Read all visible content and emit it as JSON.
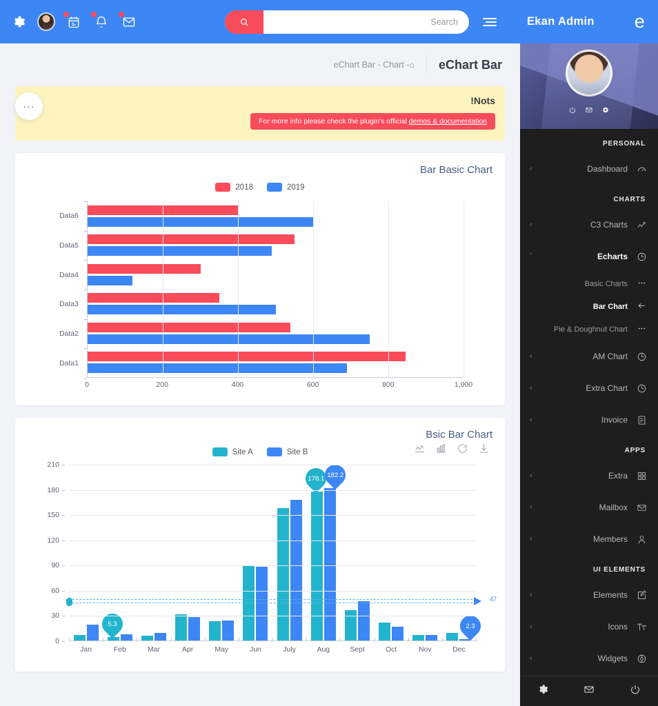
{
  "topbar": {
    "icons": [
      {
        "name": "gear-icon",
        "badge": false
      },
      {
        "name": "user-avatar",
        "badge": false
      },
      {
        "name": "calendar-icon",
        "badge": true
      },
      {
        "name": "bell-icon",
        "badge": true
      },
      {
        "name": "envelope-icon",
        "badge": true
      }
    ],
    "search": {
      "placeholder": "Search",
      "value": ""
    },
    "brand": "Ekan Admin",
    "brand_logo": "e",
    "colors": {
      "bar": "#3d86f5",
      "accent": "#fa4b5a"
    }
  },
  "page": {
    "fab_label": "···",
    "breadcrumb": "eChart Bar -   Chart -",
    "breadcrumb_home_icon": "home-icon",
    "title": "eChart Bar"
  },
  "notice": {
    "title": "!Nots",
    "text_before": "For more info please check the plugin's official ",
    "link": "demos & documentation",
    "bg": "#fdf4bf",
    "pill_bg": "#fa4b5a"
  },
  "cards": [
    {
      "title": "Bar Basic Chart"
    },
    {
      "title": "Bsic Bar Chart"
    }
  ],
  "chart_toolbar": [
    {
      "name": "line-chart-icon"
    },
    {
      "name": "bar-chart-icon"
    },
    {
      "name": "restore-icon"
    },
    {
      "name": "download-icon"
    }
  ],
  "chart_data": [
    {
      "type": "bar",
      "orientation": "horizontal",
      "title": "Bar Basic Chart",
      "categories": [
        "Data1",
        "Data2",
        "Data3",
        "Data4",
        "Data5",
        "Data6"
      ],
      "series": [
        {
          "name": "2018",
          "color": "#fa4b5a",
          "values": [
            845,
            540,
            350,
            300,
            550,
            400
          ]
        },
        {
          "name": "2019",
          "color": "#3d86f5",
          "values": [
            690,
            750,
            500,
            120,
            490,
            600
          ]
        }
      ],
      "xlabel": "",
      "ylabel": "",
      "xlim": [
        0,
        1000
      ],
      "xticks": [
        0,
        200,
        400,
        600,
        800,
        1000
      ],
      "xtick_labels": [
        "0",
        "200",
        "400",
        "600",
        "800",
        "1,000"
      ],
      "grid": true,
      "legend_position": "top-center",
      "display_order_top_to_bottom": [
        "Data6",
        "Data5",
        "Data4",
        "Data3",
        "Data2",
        "Data1"
      ]
    },
    {
      "type": "bar",
      "orientation": "vertical",
      "title": "Bsic Bar Chart",
      "categories": [
        "Jan",
        "Feb",
        "Mar",
        "Apr",
        "May",
        "Jun",
        "July",
        "Aug",
        "Sept",
        "Oct",
        "Nov",
        "Dec"
      ],
      "series": [
        {
          "name": "Site A",
          "color": "#23b4cd",
          "values": [
            7.5,
            5.3,
            6.5,
            32,
            23.5,
            90,
            158,
            178.1,
            37,
            22.5,
            7.5,
            9.5
          ]
        },
        {
          "name": "Site B",
          "color": "#3d86f5",
          "values": [
            20,
            8.5,
            9.5,
            28.5,
            25,
            89,
            168,
            182.2,
            48,
            17,
            7.5,
            2.3
          ]
        }
      ],
      "xlabel": "",
      "ylabel": "",
      "ylim": [
        0,
        210
      ],
      "yticks": [
        0,
        30,
        60,
        90,
        120,
        150,
        180,
        210
      ],
      "ytick_labels": [
        "0",
        "30",
        "60",
        "90",
        "120",
        "150",
        "180",
        "210"
      ],
      "grid": true,
      "legend_position": "top-center",
      "annotations": [
        {
          "label": "178.1",
          "series": "Site A",
          "category": "Aug",
          "type": "max-pin",
          "color": "#23b4cd"
        },
        {
          "label": "5.3",
          "series": "Site A",
          "category": "Feb",
          "type": "min-pin",
          "color": "#23b4cd"
        },
        {
          "label": "182.2",
          "series": "Site B",
          "category": "Aug",
          "type": "max-pin",
          "color": "#3d86f5"
        },
        {
          "label": "2.3",
          "series": "Site B",
          "category": "Dec",
          "type": "min-pin",
          "color": "#3d86f5"
        },
        {
          "label": "47",
          "type": "average-markline",
          "value": 48,
          "color": "#56b7f0"
        }
      ]
    }
  ],
  "sidebar": {
    "profile_icons": [
      {
        "name": "power-icon"
      },
      {
        "name": "envelope-icon"
      },
      {
        "name": "settings-dot-icon"
      }
    ],
    "groups": [
      {
        "heading": "PERSONAL",
        "items": [
          {
            "label": "Dashboard",
            "icon": "speedometer-icon",
            "chevron": "‹",
            "state": ""
          }
        ]
      },
      {
        "heading": "CHARTS",
        "items": [
          {
            "label": "C3 Charts",
            "icon": "trend-line-icon",
            "chevron": "‹",
            "state": ""
          },
          {
            "label": "Echarts",
            "icon": "pie-clock-icon",
            "chevron": "ˇ",
            "state": "open",
            "children": [
              {
                "label": "Basic Charts",
                "icon": "ellipsis-icon",
                "state": ""
              },
              {
                "label": "Bar Chart",
                "icon": "arrow-left-icon",
                "state": "active"
              },
              {
                "label": "Pie & Doughnut Chart",
                "icon": "ellipsis-icon",
                "state": ""
              }
            ]
          },
          {
            "label": "AM Chart",
            "icon": "pie-clock-icon",
            "chevron": "‹",
            "state": ""
          },
          {
            "label": "Extra Chart",
            "icon": "pie-clock-icon",
            "chevron": "‹",
            "state": ""
          },
          {
            "label": "Invoice",
            "icon": "document-icon",
            "chevron": "‹",
            "state": ""
          }
        ]
      },
      {
        "heading": "APPS",
        "items": [
          {
            "label": "Extra",
            "icon": "grid-icon",
            "chevron": "‹",
            "state": ""
          },
          {
            "label": "Mailbox",
            "icon": "envelope-icon",
            "chevron": "‹",
            "state": ""
          },
          {
            "label": "Members",
            "icon": "person-icon",
            "chevron": "‹",
            "state": ""
          }
        ]
      },
      {
        "heading": "UI ELEMENTS",
        "items": [
          {
            "label": "Elements",
            "icon": "edit-square-icon",
            "chevron": "‹",
            "state": ""
          },
          {
            "label": "Icons",
            "icon": "typography-icon",
            "chevron": "‹",
            "state": ""
          },
          {
            "label": "Widgets",
            "icon": "widget-icon",
            "chevron": "‹",
            "state": ""
          }
        ]
      }
    ],
    "footer_icons": [
      {
        "name": "gear-icon"
      },
      {
        "name": "envelope-icon"
      },
      {
        "name": "power-icon"
      }
    ]
  }
}
